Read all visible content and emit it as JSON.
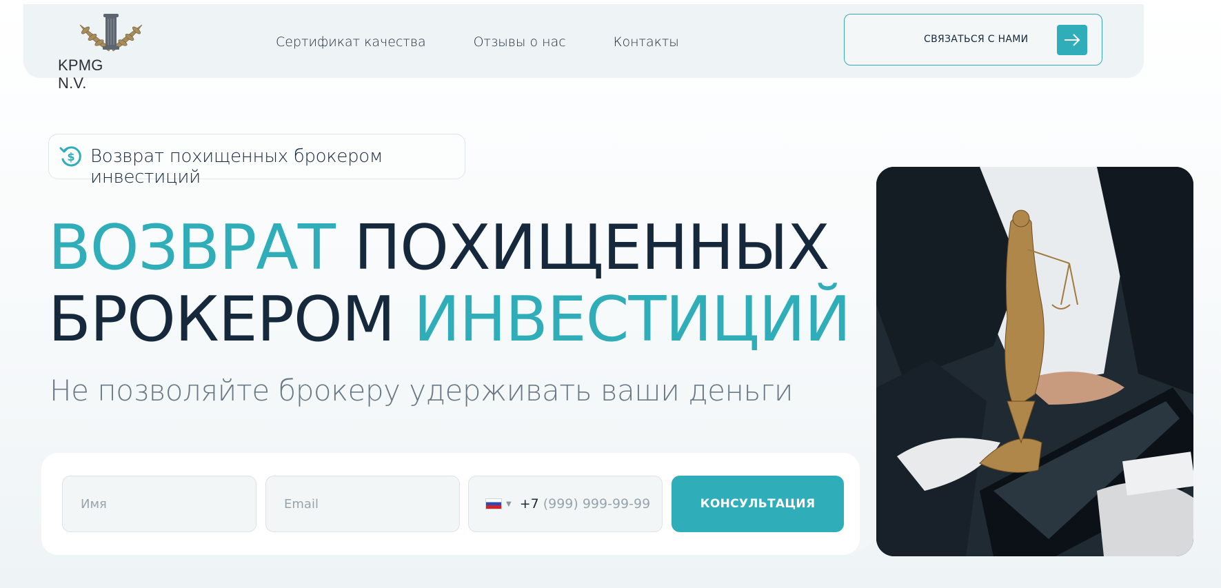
{
  "header": {
    "logo_text": "KPMG N.V.",
    "nav": [
      {
        "label": "Сертификат качества"
      },
      {
        "label": "Отзывы о нас"
      },
      {
        "label": "Контакты"
      }
    ],
    "contact_button": "СВЯЗАТЬСЯ С НАМИ"
  },
  "badge": {
    "icon": "dollar-refresh-icon",
    "text": "Возврат похищенных брокером инвестиций"
  },
  "hero": {
    "line1_accent": "ВОЗВРАТ",
    "line1_dark": "ПОХИЩЕННЫХ",
    "line2_dark": "БРОКЕРОМ",
    "line2_accent": "ИНВЕСТИЦИЙ",
    "subtitle": "Не позволяйте брокеру удерживать ваши деньги"
  },
  "form": {
    "name_placeholder": "Имя",
    "email_placeholder": "Email",
    "phone_prefix": "+7",
    "phone_placeholder": "(999) 999-99-99",
    "submit_label": "КОНСУЛЬТАЦИЯ"
  },
  "colors": {
    "accent": "#2fadb8",
    "dark": "#16283b",
    "muted": "#6a7885"
  }
}
